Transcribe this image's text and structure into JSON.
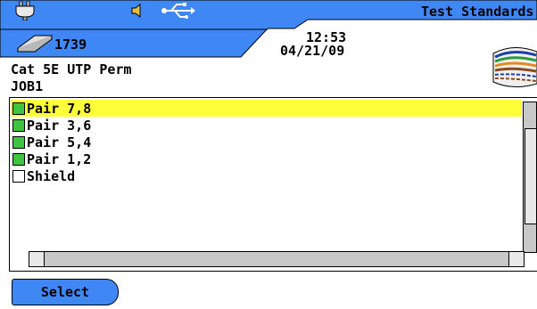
{
  "header": {
    "title": "Test Standards",
    "storage_count": "1739",
    "time": "12:53",
    "date": "04/21/09"
  },
  "cable": {
    "type": "Cat 5E UTP Perm",
    "job": "JOB1"
  },
  "list": {
    "items": [
      {
        "label": "Pair 7,8",
        "checked": true
      },
      {
        "label": "Pair 3,6",
        "checked": true
      },
      {
        "label": "Pair 5,4",
        "checked": true
      },
      {
        "label": "Pair 1,2",
        "checked": true
      },
      {
        "label": "Shield",
        "checked": false
      }
    ]
  },
  "footer": {
    "select_label": "Select"
  },
  "colors": {
    "header_blue": "#3f87f5",
    "selection_yellow": "#ffff3a",
    "check_green": "#3ec43e"
  },
  "icons": [
    "power-plug-icon",
    "speaker-icon",
    "usb-icon",
    "storage-card-icon",
    "cable-bundle-icon"
  ]
}
